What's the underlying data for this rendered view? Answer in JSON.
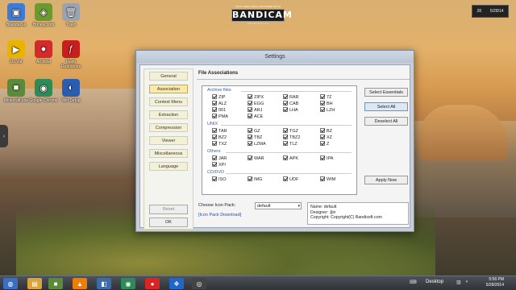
{
  "desktop": {
    "icons": [
      {
        "label": "Bluestacks",
        "glyph": "▣",
        "color": "#3d7bd6"
      },
      {
        "label": "Honeycomb",
        "glyph": "◈",
        "color": "#6c9a2e"
      },
      {
        "label": "Trash",
        "glyph": "🗑",
        "color": "#9aa4b0"
      },
      {
        "label": "Du Vid",
        "glyph": "▶",
        "color": "#e8b400"
      },
      {
        "label": "Archival",
        "glyph": "●",
        "color": "#d32b2b"
      },
      {
        "label": "Flash Resources",
        "glyph": "ƒ",
        "color": "#c81e1e"
      },
      {
        "label": "Minecraft.exe",
        "glyph": "■",
        "color": "#5a8a3a"
      },
      {
        "label": "Google Chrome",
        "glyph": "◉",
        "color": "#2e8b57"
      },
      {
        "label": "Win Setup",
        "glyph": "◐",
        "color": "#2a5db0"
      }
    ]
  },
  "watermark": {
    "top": "THIS VIDEO WAS CAPTURED WITH",
    "logo": "BANDICAM",
    "url": "www.bandicam.com"
  },
  "gadget": {
    "left": "28",
    "right": "5/28/14"
  },
  "window": {
    "title": "Settings",
    "nav": {
      "items": [
        "General",
        "Association",
        "Context Menu",
        "Extraction",
        "Compression",
        "Viewer",
        "Miscellaneous",
        "Language"
      ],
      "active_index": 1,
      "reset": "Reset",
      "ok": "OK"
    },
    "main": {
      "heading": "File Associations",
      "groups": [
        {
          "label": "Archive files",
          "items": [
            "ZIP",
            "ZIPX",
            "RAR",
            "7Z",
            "ALZ",
            "EGG",
            "CAB",
            "BH",
            "001",
            "ARJ",
            "LHA",
            "LZH",
            "PMA",
            "ACE"
          ]
        },
        {
          "label": "UNIX",
          "items": [
            "TAR",
            "GZ",
            "TGZ",
            "BZ",
            "BZ2",
            "TBZ",
            "TBZ2",
            "XZ",
            "TXZ",
            "LZMA",
            "TLZ",
            "Z"
          ]
        },
        {
          "label": "Others",
          "items": [
            "JAR",
            "WAR",
            "APK",
            "IPA",
            "XPI"
          ]
        },
        {
          "label": "CD/DVD",
          "items": [
            "ISO",
            "IMG",
            "UDF",
            "WIM"
          ]
        }
      ],
      "buttons": {
        "select_essentials": "Select Essentials",
        "select_all": "Select All",
        "deselect_all": "Deselect All",
        "apply_now": "Apply Now"
      },
      "icon_pack": {
        "label": "Choose Icon Pack:",
        "value": "default",
        "download_link": "[Icon Pack Download]"
      },
      "info": {
        "name": "Name: default",
        "designer": "Designer: Jjin",
        "copyright": "Copyright: Copyright(C) Bandisoft.com"
      }
    }
  },
  "taskbar": {
    "desktop_label": "Desktop",
    "time": "5:56 PM",
    "date": "5/28/2014",
    "apps": [
      {
        "name": "start-orb",
        "glyph": "◍",
        "color": "#3a6fc4"
      },
      {
        "name": "explorer",
        "glyph": "▤",
        "color": "#d9a53a"
      },
      {
        "name": "minecraft",
        "glyph": "■",
        "color": "#5a8a3a"
      },
      {
        "name": "vlc",
        "glyph": "▲",
        "color": "#f07d00"
      },
      {
        "name": "settings-app",
        "glyph": "◧",
        "color": "#3b6ca8"
      },
      {
        "name": "chrome",
        "glyph": "◉",
        "color": "#2e8b57"
      },
      {
        "name": "record",
        "glyph": "●",
        "color": "#d22"
      },
      {
        "name": "windows",
        "glyph": "❖",
        "color": "#1e66c8"
      },
      {
        "name": "game",
        "glyph": "◎",
        "color": "#444"
      }
    ]
  }
}
